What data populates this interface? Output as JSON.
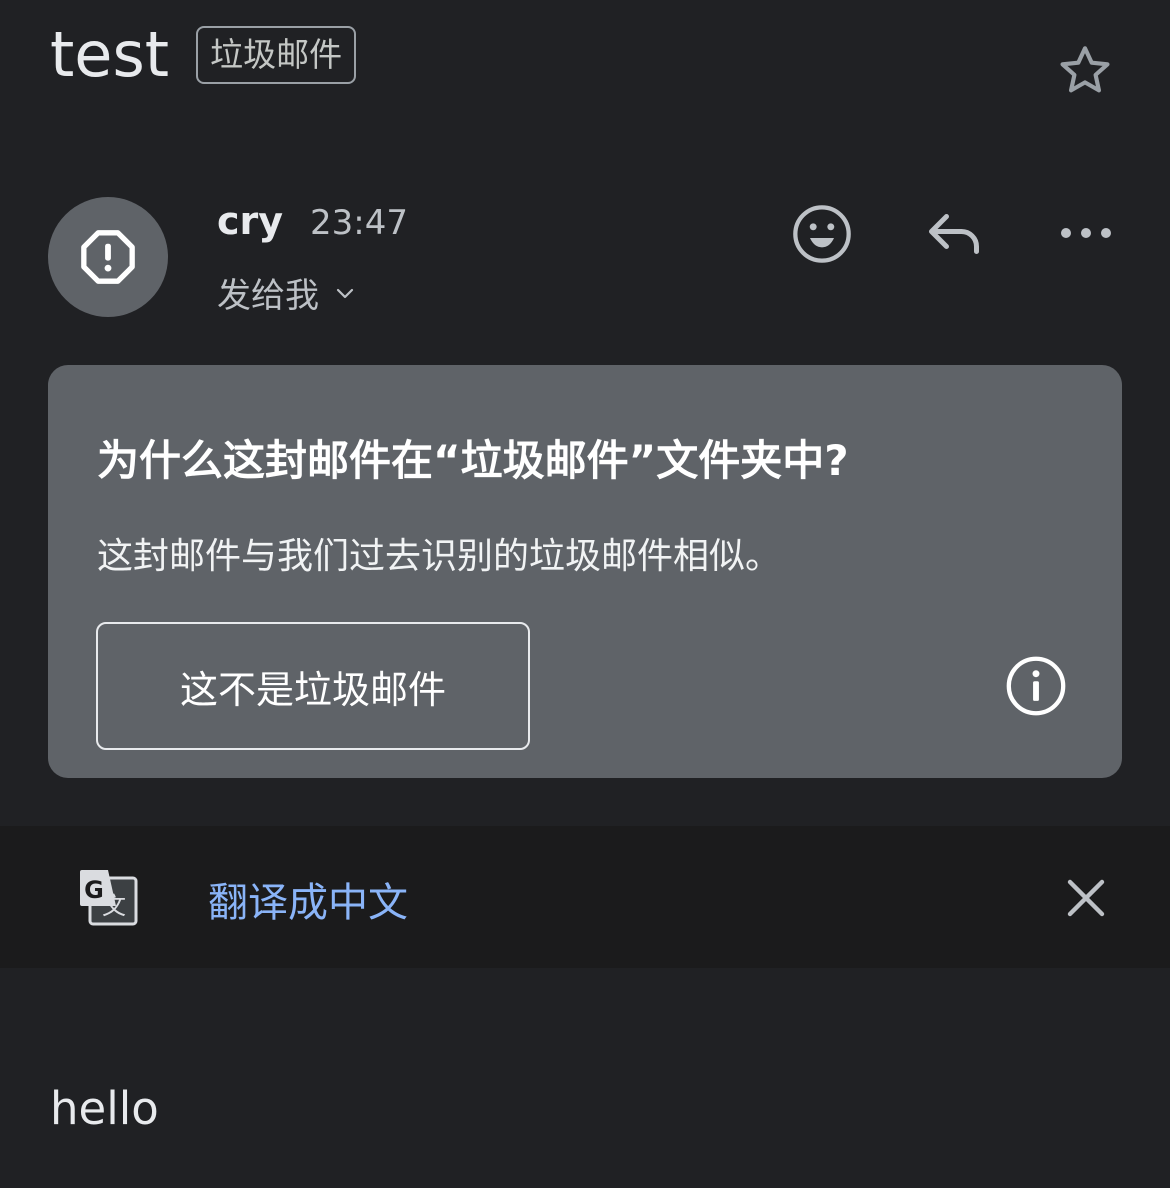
{
  "subject": {
    "title": "test",
    "label": "垃圾邮件"
  },
  "header": {
    "star_icon": "star-outline-icon"
  },
  "sender": {
    "name": "cry",
    "time": "23:47",
    "recipient_text": "发给我",
    "avatar_icon": "spam-warning-icon"
  },
  "actions": {
    "emoji_icon": "smiley-icon",
    "reply_icon": "reply-icon",
    "more_icon": "more-horizontal-icon"
  },
  "spam_notice": {
    "title": "为什么这封邮件在“垃圾邮件”文件夹中?",
    "body": "这封邮件与我们过去识别的垃圾邮件相似。",
    "not_spam_label": "这不是垃圾邮件",
    "info_icon": "info-icon"
  },
  "translate_bar": {
    "link_text": "翻译成中文",
    "translate_icon": "google-translate-icon",
    "close_icon": "close-icon"
  },
  "message": {
    "body": "hello"
  },
  "colors": {
    "background": "#202124",
    "card": "#5f6368",
    "link": "#8ab4f8",
    "translate_bar": "#1b1b1c"
  }
}
